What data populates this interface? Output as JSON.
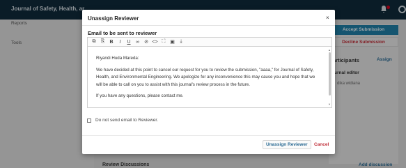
{
  "app": {
    "journal_title": "Journal of Safety, Health, ar",
    "nav": [
      "Reports",
      "Tools"
    ],
    "actions": {
      "accept": "Accept Submission",
      "decline": "Decline Submission"
    },
    "participants": {
      "title": "articipants",
      "assign": "Assign",
      "group": "urnal editor",
      "member": "dika widiana"
    },
    "discussions": {
      "title": "Review Discussions",
      "add": "Add discussion"
    }
  },
  "modal": {
    "title": "Unassign Reviewer",
    "close": "×",
    "email_label": "Email to be sent to reviewer",
    "toolbar": [
      "copy-icon",
      "paste-icon",
      "bold-icon",
      "italic-icon",
      "underline-icon",
      "link-icon",
      "unlink-icon",
      "code-icon",
      "fullscreen-icon",
      "image-icon",
      "upload-icon"
    ],
    "toolbar_glyphs": [
      "⧉",
      "⎘",
      "B",
      "I",
      "U",
      "∞",
      "⊘",
      "<>",
      "⛶",
      "▣",
      "⤓"
    ],
    "email_body": [
      "Riyandi Huda Mareda:",
      "We have decided at this point to cancel our request for you to review the submission, \"aaaa,\" for Journal of Safety, Health, and Environmental Engineering. We apologize for any inconvenience this may cause you and hope that we will be able to call on you to assist with this journal's review process in the future.",
      "If you have any questions, please contact me."
    ],
    "skip_email_label": "Do not send email to Reviewer.",
    "skip_email_checked": false,
    "submit_label": "Unassign Reviewer",
    "cancel_label": "Cancel"
  },
  "colors": {
    "accent": "#1f7ea6",
    "danger": "#c0303a",
    "header": "#0f2a3a"
  }
}
